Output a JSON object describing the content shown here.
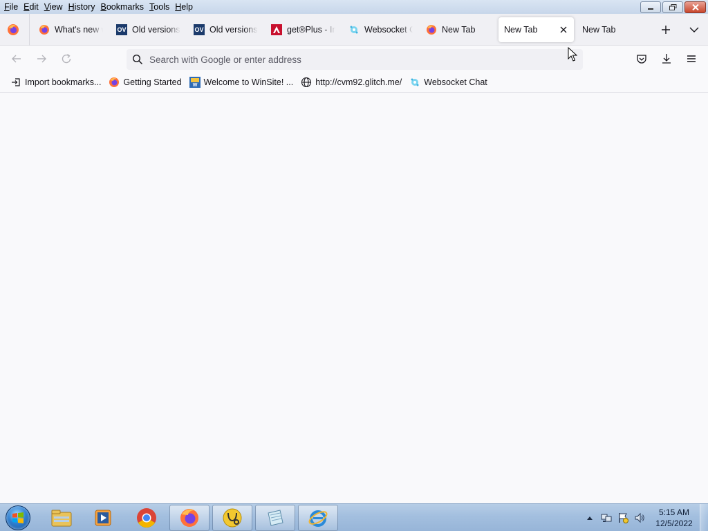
{
  "menu": {
    "items": [
      "File",
      "Edit",
      "View",
      "History",
      "Bookmarks",
      "Tools",
      "Help"
    ]
  },
  "window_controls": {
    "minimize": "minimize-icon",
    "restore": "restore-icon",
    "close": "close-icon"
  },
  "tabs": [
    {
      "label": "What's new with Firefox",
      "icon": "firefox-icon",
      "active": false
    },
    {
      "label": "Old versions of Firefox",
      "icon": "oldversion-icon",
      "icon_text": "OV",
      "active": false
    },
    {
      "label": "Old versions of Opera",
      "icon": "oldversion-icon",
      "icon_text": "OV",
      "active": false
    },
    {
      "label": "get®Plus - Install",
      "icon": "adobe-icon",
      "active": false
    },
    {
      "label": "Websocket Chat",
      "icon": "glitch-icon",
      "active": false
    },
    {
      "label": "New Tab",
      "icon": "firefox-icon",
      "active": false
    },
    {
      "label": "New Tab",
      "icon": "",
      "active": true
    },
    {
      "label": "New Tab",
      "icon": "",
      "active": false
    }
  ],
  "urlbar": {
    "placeholder": "Search with Google or enter address",
    "value": ""
  },
  "bookmarks": [
    {
      "label": "Import bookmarks...",
      "icon": "import-icon"
    },
    {
      "label": "Getting Started",
      "icon": "firefox-icon"
    },
    {
      "label": "Welcome to WinSite! ...",
      "icon": "winsite-icon"
    },
    {
      "label": "http://cvm92.glitch.me/",
      "icon": "globe-icon"
    },
    {
      "label": "Websocket Chat",
      "icon": "glitch-icon"
    }
  ],
  "taskbar": {
    "apps": [
      "explorer-icon",
      "media-player-icon",
      "chrome-icon",
      "firefox-icon",
      "app-icon",
      "notepad-icon",
      "ie-icon"
    ]
  },
  "clock": {
    "time": "5:15 AM",
    "date": "12/5/2022"
  },
  "colors": {
    "accent": "#0061e0",
    "firefox_orange": "#ff7139",
    "firefox_purple": "#7542e5"
  }
}
